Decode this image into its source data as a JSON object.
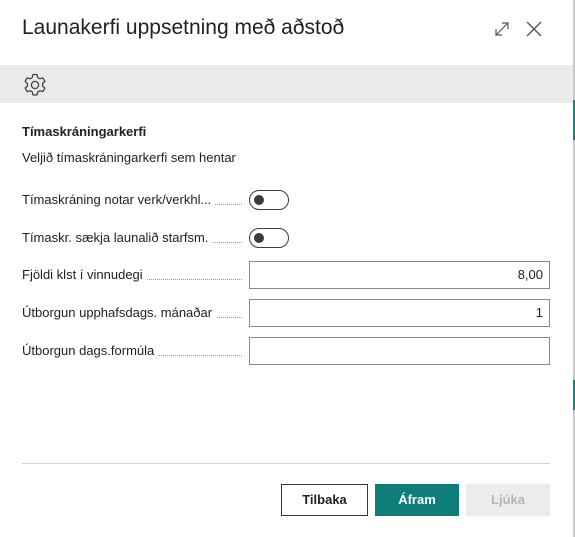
{
  "dialog": {
    "title": "Launakerfi uppsetning með aðstoð",
    "expand_icon": "expand-icon",
    "close_icon": "close-icon"
  },
  "toolbar": {
    "settings_icon": "gear-icon"
  },
  "section": {
    "title": "Tímaskráningarkerfi",
    "description": "Veljið tímaskráningarkerfi sem hentar"
  },
  "fields": [
    {
      "label": "Tímaskráning notar verk/verkhl...",
      "type": "toggle",
      "value": false
    },
    {
      "label": "Tímaskr. sækja launalið starfsm.",
      "type": "toggle",
      "value": false
    },
    {
      "label": "Fjöldi klst í vinnudegi",
      "type": "input",
      "value": "8,00"
    },
    {
      "label": "Útborgun upphafsdags. mánaðar",
      "type": "input",
      "value": "1"
    },
    {
      "label": "Útborgun dags.formúla",
      "type": "input",
      "value": ""
    }
  ],
  "buttons": {
    "back": "Tilbaka",
    "next": "Áfram",
    "finish": "Ljúka"
  },
  "colors": {
    "primary": "#0f7d79",
    "toolbar_bg": "#eaeaea",
    "disabled_bg": "#ececec"
  }
}
